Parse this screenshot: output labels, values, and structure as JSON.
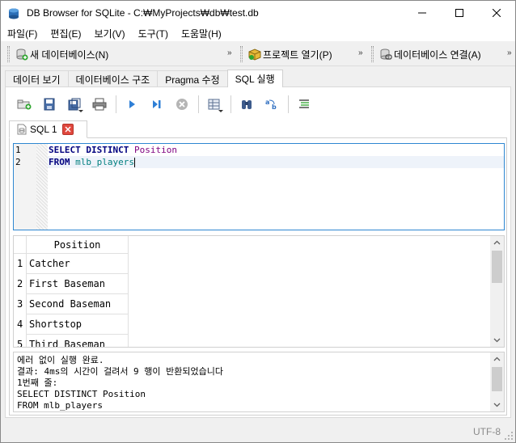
{
  "window": {
    "title": "DB Browser for SQLite - C:₩MyProjects₩db₩test.db"
  },
  "menu": [
    {
      "label": "파일(F)"
    },
    {
      "label": "편집(E)"
    },
    {
      "label": "보기(V)"
    },
    {
      "label": "도구(T)"
    },
    {
      "label": "도움말(H)"
    }
  ],
  "toolbar": {
    "new_db": "새 데이터베이스(N)",
    "open_project": "프로젝트 열기(P)",
    "connect_db": "데이터베이스 연결(A)",
    "more": "»"
  },
  "tabs": [
    {
      "label": "데이터 보기"
    },
    {
      "label": "데이터베이스 구조"
    },
    {
      "label": "Pragma 수정"
    },
    {
      "label": "SQL 실행",
      "active": true
    }
  ],
  "sql_tab": {
    "label": "SQL 1"
  },
  "editor": {
    "lines": [
      {
        "num": "1",
        "kw": "SELECT DISTINCT",
        "rest": "Position"
      },
      {
        "num": "2",
        "kw": "FROM",
        "rest": "mlb_players"
      }
    ]
  },
  "results": {
    "column": "Position",
    "rows": [
      {
        "num": "1",
        "value": "Catcher"
      },
      {
        "num": "2",
        "value": "First Baseman"
      },
      {
        "num": "3",
        "value": "Second Baseman"
      },
      {
        "num": "4",
        "value": "Shortstop"
      },
      {
        "num": "5",
        "value": "Third Baseman"
      }
    ]
  },
  "log": {
    "lines": [
      "에러 없이 실행 완료.",
      "결과: 4ms의 시간이 걸려서 9 행이 반환되었습니다",
      "1번째 줄:",
      "SELECT DISTINCT Position",
      "FROM mlb_players"
    ]
  },
  "status": {
    "encoding": "UTF-8"
  }
}
